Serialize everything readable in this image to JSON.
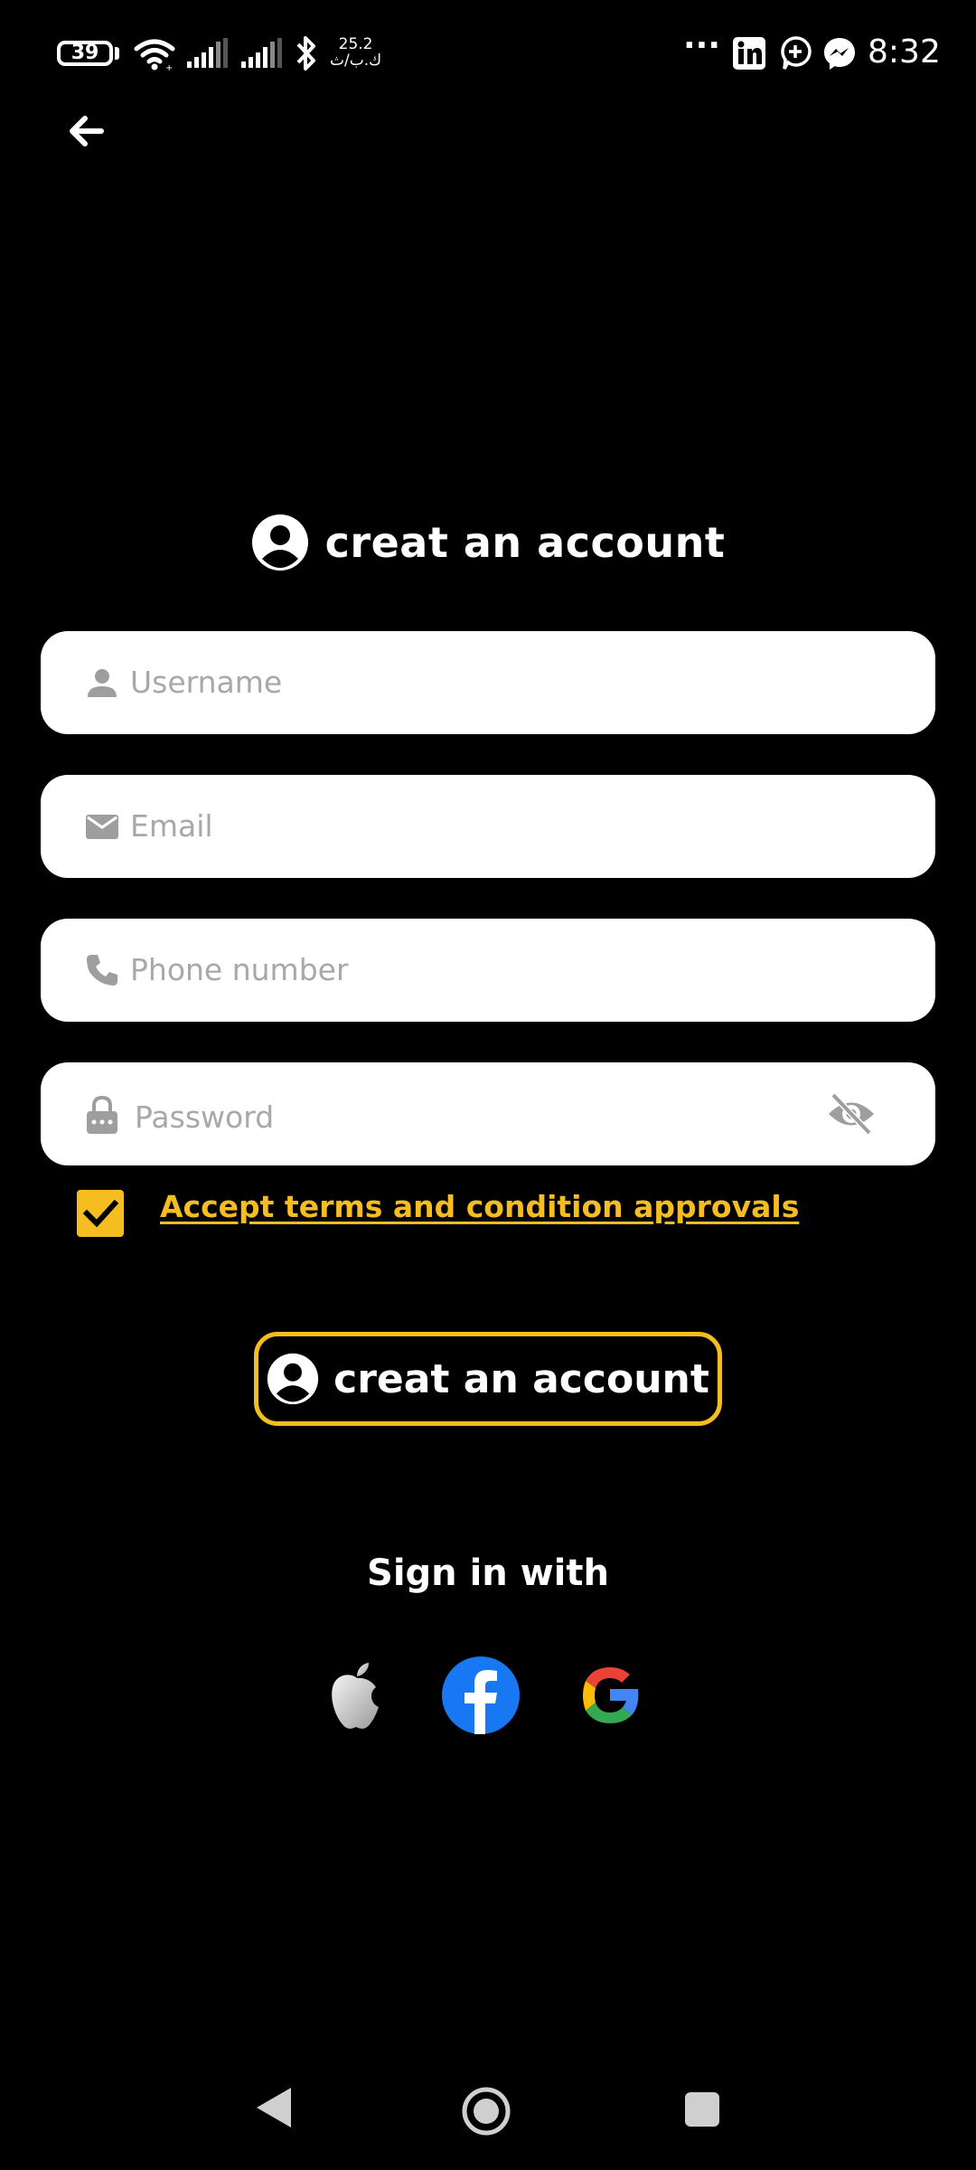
{
  "status_bar": {
    "battery_level": "39",
    "net_speed_value": "25.2",
    "net_speed_unit": "ك.ب/ث",
    "overflow": "···",
    "time": "8:32"
  },
  "header": {
    "title": "creat an account"
  },
  "form": {
    "username_placeholder": "Username",
    "email_placeholder": "Email",
    "phone_placeholder": "Phone number",
    "password_placeholder": "Password",
    "terms_label": "Accept terms and condition approvals",
    "terms_checked": true
  },
  "create_button_label": "creat an account",
  "signin_label": "Sign in with",
  "colors": {
    "accent": "#f5bd1f",
    "background": "#000000",
    "field": "#ffffff",
    "placeholder": "#a8a8a8"
  },
  "icons": [
    "back-arrow-icon",
    "account-circle-icon",
    "person-icon",
    "mail-icon",
    "phone-icon",
    "lock-icon",
    "eye-off-icon",
    "check-icon",
    "apple-icon",
    "facebook-icon",
    "google-icon"
  ]
}
